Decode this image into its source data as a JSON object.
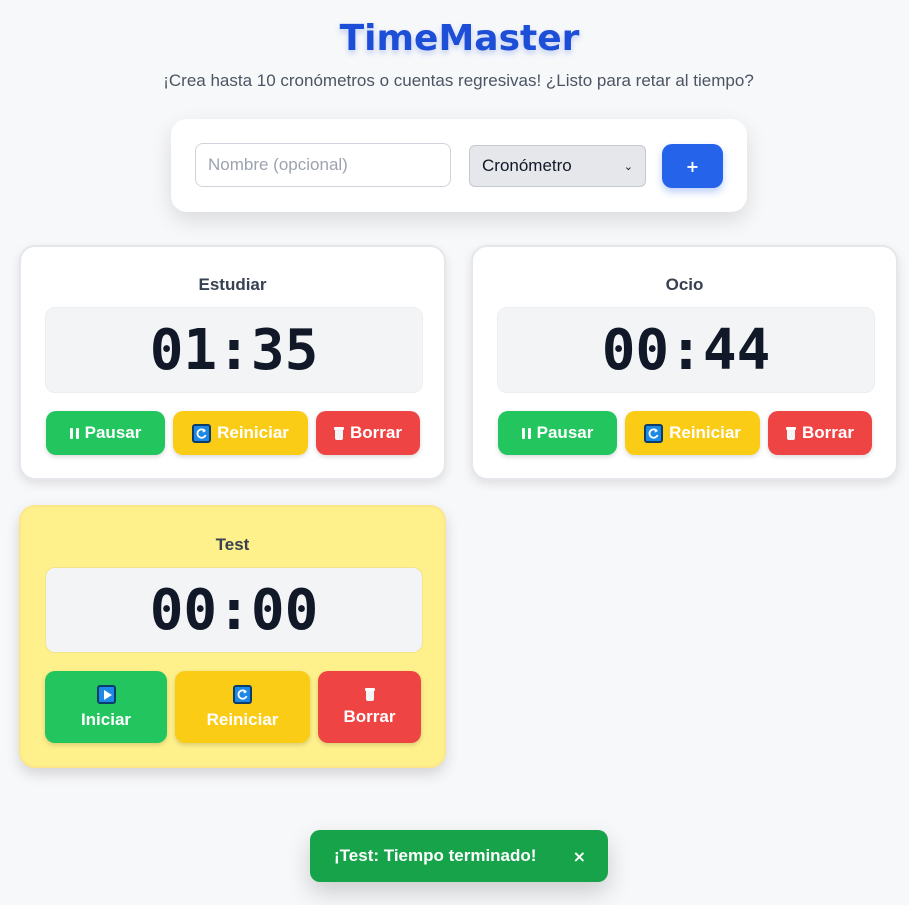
{
  "app": {
    "title": "TimeMaster",
    "subtitle": "¡Crea hasta 10 cronómetros o cuentas regresivas! ¿Listo para retar al tiempo?"
  },
  "create": {
    "name_placeholder": "Nombre (opcional)",
    "name_value": "",
    "type_selected": "Cronómetro",
    "add_label": "+"
  },
  "timers": [
    {
      "name": "Estudiar",
      "time": "01:35",
      "primary_label": "Pausar",
      "primary_icon": "pause-icon",
      "reset_label": "Reiniciar",
      "reset_icon": "reload-icon",
      "delete_label": "Borrar",
      "delete_icon": "trash-icon"
    },
    {
      "name": "Ocio",
      "time": "00:44",
      "primary_label": "Pausar",
      "primary_icon": "pause-icon",
      "reset_label": "Reiniciar",
      "reset_icon": "reload-icon",
      "delete_label": "Borrar",
      "delete_icon": "trash-icon"
    },
    {
      "name": "Test",
      "time": "00:00",
      "primary_label": "Iniciar",
      "primary_icon": "play-icon",
      "reset_label": "Reiniciar",
      "reset_icon": "reload-icon",
      "delete_label": "Borrar",
      "delete_icon": "trash-icon",
      "state": "finished"
    }
  ],
  "toast": {
    "message": "¡Test: Tiempo terminado!",
    "close_label": "×"
  },
  "colors": {
    "brand": "#1d4ed8",
    "add_button": "#2563eb",
    "start_pause": "#22c55e",
    "reset": "#facc15",
    "delete": "#ef4444",
    "finished_card": "#fef08a",
    "toast": "#16a34a"
  }
}
